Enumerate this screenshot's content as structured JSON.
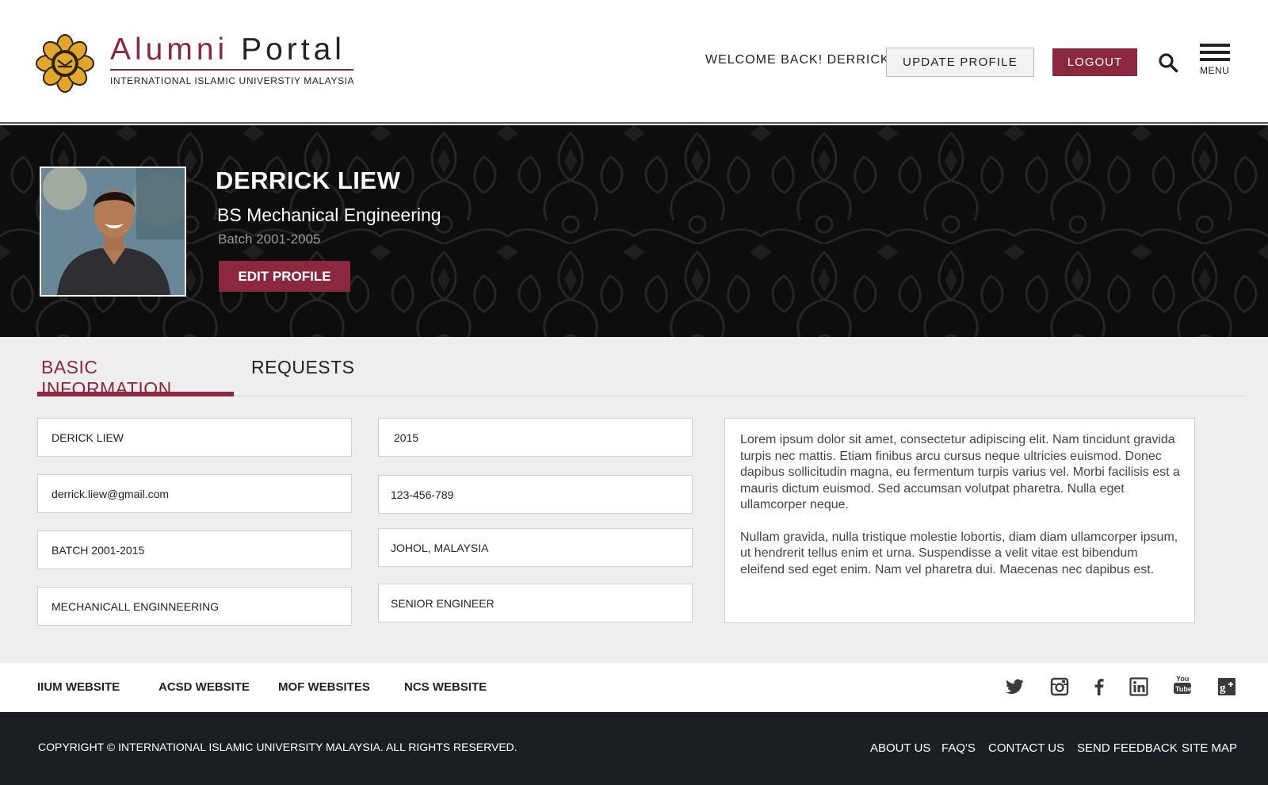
{
  "header": {
    "brand_title_1": "Alumni",
    "brand_title_2": "Portal",
    "brand_subtitle": "INTERNATIONAL ISLAMIC UNIVERSTIY MALAYSIA",
    "welcome_text": "WELCOME BACK! DERRICK",
    "update_profile_label": "UPDATE PROFILE",
    "logout_label": "LOGOUT",
    "menu_label": "MENU"
  },
  "profile": {
    "name": "DERRICK LIEW",
    "degree": "BS Mechanical Engineering",
    "batch": "Batch 2001-2005",
    "edit_label": "EDIT PROFILE"
  },
  "tabs": [
    {
      "label": "BASIC INFORMATION",
      "active": true
    },
    {
      "label": "REQUESTS",
      "active": false
    }
  ],
  "fields": {
    "full_name": "DERICK LIEW",
    "email": "derrick.liew@gmail.com",
    "batch": "BATCH 2001-2015",
    "program": "MECHANICALL ENGINNEERING",
    "year": "2015",
    "phone": "123-456-789",
    "location": "JOHOL, MALAYSIA",
    "position": "SENIOR ENGINEER"
  },
  "about": {
    "paragraph_1": "Lorem ipsum dolor sit amet, consectetur adipiscing elit. Nam tincidunt gravida turpis nec mattis. Etiam finibus arcu cursus neque ultricies euismod. Donec dapibus sollicitudin magna, eu fermentum turpis varius vel. Morbi facilisis est a mauris dictum euismod. Sed accumsan volutpat pharetra. Nulla eget ullamcorper neque.",
    "paragraph_2": "Nullam gravida, nulla tristique molestie lobortis, diam diam ullamcorper ipsum, ut hendrerit tellus enim et urna. Suspendisse a velit vitae est bibendum eleifend sed eget enim. Nam vel pharetra dui. Maecenas nec dapibus est."
  },
  "external_links": [
    "IIUM WEBSITE",
    "ACSD WEBSITE",
    "MOF WEBSITES",
    "NCS WEBSITE"
  ],
  "social_icons": [
    "twitter-icon",
    "instagram-icon",
    "facebook-icon",
    "linkedin-icon",
    "youtube-icon",
    "google-plus-icon"
  ],
  "footer": {
    "copyright": "COPYRIGHT © INTERNATIONAL ISLAMIC UNIVERSITY MALAYSIA. ALL RIGHTS RESERVED.",
    "links": [
      "ABOUT US",
      "FAQ'S",
      "CONTACT US",
      "SEND FEEDBACK",
      "SITE MAP"
    ]
  },
  "colors": {
    "brand": "#8b2840",
    "hero_bg": "#0d0d0d",
    "footer_bg": "#1b1e23",
    "page_bg": "#eeeeee"
  }
}
